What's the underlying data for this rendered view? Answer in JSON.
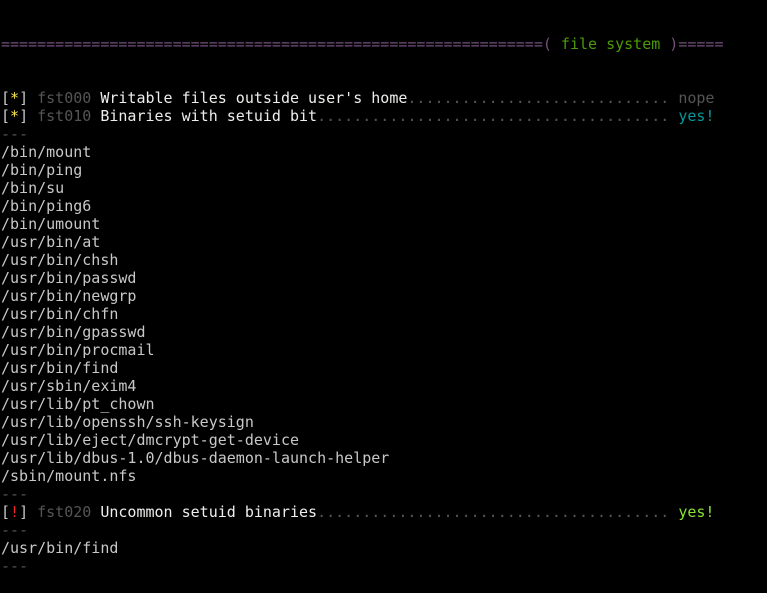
{
  "header": {
    "left_rule": "============================================================",
    "open": "( ",
    "title": "file system",
    "close": " )",
    "right_rule": "====="
  },
  "separator": "---",
  "checks": [
    {
      "marker": "*",
      "id": "fst000",
      "label": "Writable files outside user's home",
      "result": "nope",
      "result_color": "#555555"
    },
    {
      "marker": "*",
      "id": "fst010",
      "label": "Binaries with setuid bit",
      "result": "yes!",
      "result_color": "#06989a"
    },
    {
      "marker": "!",
      "id": "fst020",
      "label": "Uncommon setuid binaries",
      "result": "yes!",
      "result_color": "#8ae234"
    }
  ],
  "setuid_files": [
    "/bin/mount",
    "/bin/ping",
    "/bin/su",
    "/bin/ping6",
    "/bin/umount",
    "/usr/bin/at",
    "/usr/bin/chsh",
    "/usr/bin/passwd",
    "/usr/bin/newgrp",
    "/usr/bin/chfn",
    "/usr/bin/gpasswd",
    "/usr/bin/procmail",
    "/usr/bin/find",
    "/usr/sbin/exim4",
    "/usr/lib/pt_chown",
    "/usr/lib/openssh/ssh-keysign",
    "/usr/lib/eject/dmcrypt-get-device",
    "/usr/lib/dbus-1.0/dbus-daemon-launch-helper",
    "/sbin/mount.nfs"
  ],
  "uncommon_files": [
    "/usr/bin/find"
  ]
}
